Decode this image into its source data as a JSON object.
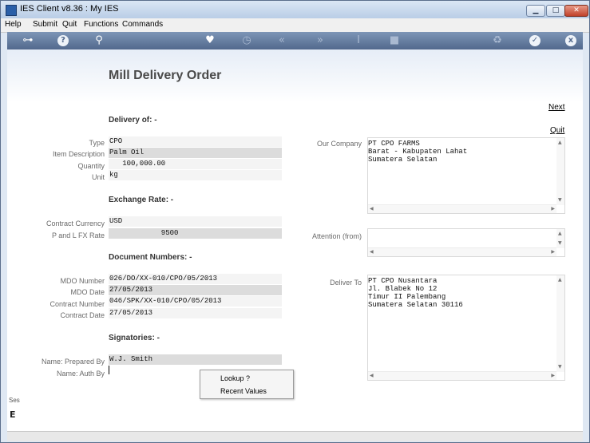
{
  "window": {
    "title": "IES Client v8.36 : My IES",
    "minimize": "▁",
    "maximize": "□",
    "close": "✕"
  },
  "menu": [
    "Help",
    "Submit",
    "Quit",
    "Functions",
    "Commands"
  ],
  "toolbar": {
    "icons": [
      "key-icon",
      "help-icon",
      "search-icon",
      "heart-icon",
      "clock-icon",
      "rewind-icon",
      "fast-forward-icon",
      "text-cursor-icon",
      "stop-icon",
      "recycle-icon",
      "check-icon",
      "close-icon"
    ],
    "glyphs": {
      "key": "⊶",
      "help": "?",
      "search": "⚲",
      "heart": "♥",
      "clock": "◷",
      "rewind": "«",
      "ffwd": "»",
      "cursor": "I",
      "stop": "■",
      "recycle": "♻",
      "check": "✓",
      "close": "x"
    }
  },
  "page": {
    "title": "Mill Delivery Order",
    "next": "Next",
    "quit": "Quit"
  },
  "delivery": {
    "heading": "Delivery of: -",
    "type_label": "Type",
    "type_value": "CPO",
    "item_label": "Item Description",
    "item_value": "Palm Oil",
    "qty_label": "Quantity",
    "qty_value": "   100,000.00",
    "unit_label": "Unit",
    "unit_value": "kg"
  },
  "exchange": {
    "heading": "Exchange Rate: -",
    "currency_label": "Contract Currency",
    "currency_value": "USD",
    "rate_label": "P and L  FX Rate",
    "rate_value": "            9500"
  },
  "documents": {
    "heading": "Document Numbers: -",
    "mdo_number_label": "MDO Number",
    "mdo_number_value": "026/DO/XX-010/CPO/05/2013",
    "mdo_date_label": "MDO Date",
    "mdo_date_value": "27/05/2013",
    "contract_number_label": "Contract Number",
    "contract_number_value": "046/SPK/XX-010/CPO/05/2013",
    "contract_date_label": "Contract Date",
    "contract_date_value": "27/05/2013"
  },
  "signatories": {
    "heading": "Signatories: -",
    "prepared_label": "Name: Prepared By",
    "prepared_value": "W.J. Smith",
    "auth_label": "Name: Auth By",
    "auth_value": ""
  },
  "our_company": {
    "label": "Our Company",
    "text": "PT CPO FARMS\nBarat - Kabupaten Lahat\nSumatera Selatan"
  },
  "attention": {
    "label": "Attention (from)",
    "text": ""
  },
  "deliver_to": {
    "label": "Deliver To",
    "text": "PT CPO Nusantara\nJl. Blabek No 12\nTimur II Palembang\nSumatera Selatan 30116"
  },
  "context_menu": {
    "items": [
      "Lookup ?",
      "Recent Values"
    ]
  },
  "side": {
    "text": "Ses",
    "mark": "E"
  }
}
